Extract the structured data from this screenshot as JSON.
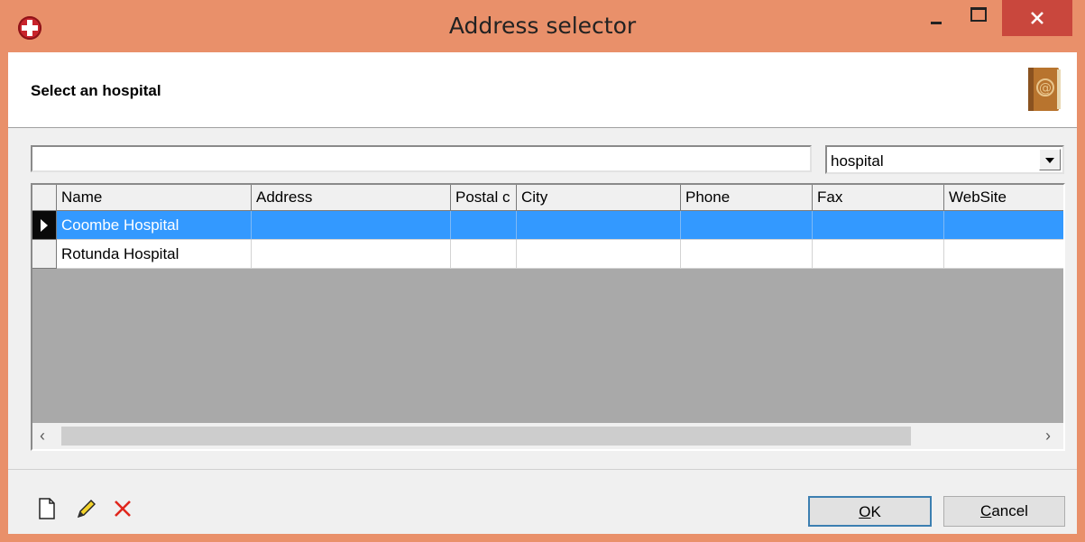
{
  "window": {
    "title": "Address selector",
    "accent_close": "#c9473d",
    "frame_color": "#e9906a"
  },
  "header": {
    "title": "Select an hospital",
    "icon": "address-book-icon"
  },
  "search": {
    "value": "",
    "category_selected": "hospital"
  },
  "table": {
    "columns": [
      "Name",
      "Address",
      "Postal c",
      "City",
      "Phone",
      "Fax",
      "WebSite"
    ],
    "rows": [
      {
        "name": "Coombe Hospital",
        "address": "",
        "postal": "",
        "city": "",
        "phone": "",
        "fax": "",
        "website": "",
        "selected": true
      },
      {
        "name": "Rotunda Hospital",
        "address": "",
        "postal": "",
        "city": "",
        "phone": "",
        "fax": "",
        "website": "",
        "selected": false
      }
    ],
    "selection_color": "#3399ff"
  },
  "toolbar": {
    "new_icon": "new-document-icon",
    "edit_icon": "pencil-icon",
    "delete_icon": "delete-x-icon"
  },
  "buttons": {
    "ok_mnemonic": "O",
    "ok_rest": "K",
    "cancel_mnemonic": "C",
    "cancel_rest": "ancel"
  }
}
